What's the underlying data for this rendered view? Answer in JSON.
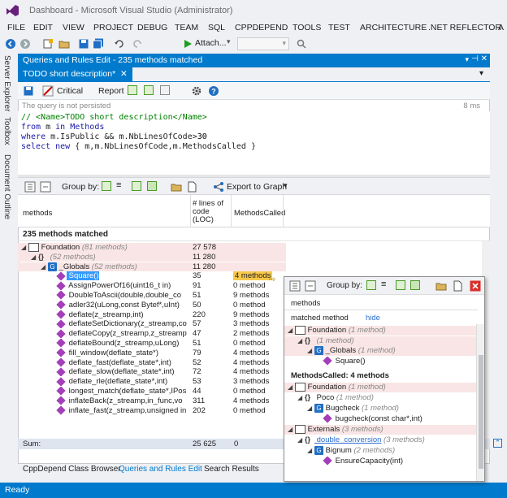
{
  "window": {
    "title": "Dashboard - Microsoft Visual Studio (Administrator)"
  },
  "menu": [
    "FILE",
    "EDIT",
    "VIEW",
    "PROJECT",
    "DEBUG",
    "TEAM",
    "SQL",
    "CPPDEPEND",
    "TOOLS",
    "TEST",
    "ARCHITECTURE",
    ".NET REFLECTOR",
    "A"
  ],
  "toolbar": {
    "attach_label": "Attach..."
  },
  "side_tabs": [
    "Server Explorer",
    "Toolbox",
    "Document Outline"
  ],
  "panel": {
    "header": "Queries and Rules Edit - 235 methods matched",
    "tab": "TODO short description*",
    "critical_label": "Critical",
    "report_label": "Report",
    "notice": "The query is not persisted",
    "time": "8 ms"
  },
  "code": {
    "line1": "// <Name>TODO short description</Name>",
    "line2_kw": "from",
    "line2_var": " m ",
    "line2_in": "in",
    "line2_rest": " Methods",
    "line3_kw": "where",
    "line3_rest": " m.IsPublic && m.NbLinesOfCode>",
    "line3_num": "30",
    "line4_kw": "select new",
    "line4_rest": " { m,m.NbLinesOfCode,m.MethodsCalled }"
  },
  "groupbar": {
    "group_by": "Group by:",
    "export": "Export to Graph"
  },
  "grid": {
    "col_methods": "methods",
    "col_loc": "# lines of code (LOC)",
    "col_called": "MethodsCalled",
    "matched": "235 methods matched",
    "rows": [
      {
        "indent": 0,
        "kind": "asm",
        "name": "Foundation",
        "note": "(81 methods)",
        "loc": "27 578",
        "called": "",
        "pink": true
      },
      {
        "indent": 1,
        "kind": "ns",
        "name": "",
        "note": "(52 methods)",
        "loc": "11 280",
        "called": "",
        "pink": true
      },
      {
        "indent": 2,
        "kind": "cls",
        "name": "_Globals",
        "note": "(52 methods)",
        "loc": "11 280",
        "called": "",
        "pink": true
      },
      {
        "indent": 3,
        "kind": "m",
        "name": "Square()",
        "note": "",
        "loc": "35",
        "called": "4 methods",
        "pink": false,
        "sel": true
      },
      {
        "indent": 3,
        "kind": "m",
        "name": "AssignPowerOf16(uint16_t in)",
        "note": "",
        "loc": "91",
        "called": "0 method",
        "pink": false
      },
      {
        "indent": 3,
        "kind": "m",
        "name": "DoubleToAscii(double,double_co",
        "note": "",
        "loc": "51",
        "called": "9 methods",
        "pink": false
      },
      {
        "indent": 3,
        "kind": "m",
        "name": "adler32(uLong,const Bytef*,uInt)",
        "note": "",
        "loc": "50",
        "called": "0 method",
        "pink": false
      },
      {
        "indent": 3,
        "kind": "m",
        "name": "deflate(z_streamp,int)",
        "note": "",
        "loc": "220",
        "called": "9 methods",
        "pink": false
      },
      {
        "indent": 3,
        "kind": "m",
        "name": "deflateSetDictionary(z_streamp,co",
        "note": "",
        "loc": "57",
        "called": "3 methods",
        "pink": false
      },
      {
        "indent": 3,
        "kind": "m",
        "name": "deflateCopy(z_streamp,z_streamp",
        "note": "",
        "loc": "47",
        "called": "2 methods",
        "pink": false
      },
      {
        "indent": 3,
        "kind": "m",
        "name": "deflateBound(z_streamp,uLong)",
        "note": "",
        "loc": "51",
        "called": "0 method",
        "pink": false
      },
      {
        "indent": 3,
        "kind": "m",
        "name": "fill_window(deflate_state*)",
        "note": "",
        "loc": "79",
        "called": "4 methods",
        "pink": false
      },
      {
        "indent": 3,
        "kind": "m",
        "name": "deflate_fast(deflate_state*,int)",
        "note": "",
        "loc": "52",
        "called": "4 methods",
        "pink": false
      },
      {
        "indent": 3,
        "kind": "m",
        "name": "deflate_slow(deflate_state*,int)",
        "note": "",
        "loc": "72",
        "called": "4 methods",
        "pink": false
      },
      {
        "indent": 3,
        "kind": "m",
        "name": "deflate_rle(deflate_state*,int)",
        "note": "",
        "loc": "53",
        "called": "3 methods",
        "pink": false
      },
      {
        "indent": 3,
        "kind": "m",
        "name": "longest_match(deflate_state*,IPos",
        "note": "",
        "loc": "44",
        "called": "0 method",
        "pink": false
      },
      {
        "indent": 3,
        "kind": "m",
        "name": "inflateBack(z_streamp,in_func,vo",
        "note": "",
        "loc": "311",
        "called": "4 methods",
        "pink": false
      },
      {
        "indent": 3,
        "kind": "m",
        "name": "inflate_fast(z_streamp,unsigned in",
        "note": "",
        "loc": "202",
        "called": "0 method",
        "pink": false
      }
    ],
    "sum_label": "Sum:",
    "sum_loc": "25 625",
    "sum_called": "0"
  },
  "bottom_tabs": [
    "CppDepend Class Browser",
    "Queries and Rules Edit",
    "Search Results"
  ],
  "status": "Ready",
  "popup": {
    "group_by": "Group by:",
    "col_methods": "methods",
    "matched_method": "matched method",
    "hide": "hide",
    "rows1": [
      {
        "indent": 0,
        "kind": "asm",
        "name": "Foundation",
        "note": "(1 method)"
      },
      {
        "indent": 1,
        "kind": "ns",
        "name": "",
        "note": "(1 method)"
      },
      {
        "indent": 2,
        "kind": "cls",
        "name": "_Globals",
        "note": "(1 method)"
      },
      {
        "indent": 3,
        "kind": "m",
        "name": "Square()",
        "note": ""
      }
    ],
    "called_title": "MethodsCalled: 4 methods",
    "rows2": [
      {
        "indent": 0,
        "kind": "asm",
        "name": "Foundation",
        "note": "(1 method)",
        "pink": true
      },
      {
        "indent": 1,
        "kind": "ns",
        "name": "Poco",
        "note": "(1 method)",
        "pink": false
      },
      {
        "indent": 2,
        "kind": "cls",
        "name": "Bugcheck",
        "note": "(1 method)",
        "pink": false
      },
      {
        "indent": 3,
        "kind": "m",
        "name": "bugcheck(const char*,int)",
        "note": "",
        "pink": false
      },
      {
        "indent": 0,
        "kind": "asm",
        "name": "Externals",
        "note": "(3 methods)",
        "pink": true
      },
      {
        "indent": 1,
        "kind": "ns",
        "name": "double_conversion",
        "note": "(3 methods)",
        "pink": false,
        "link": true
      },
      {
        "indent": 2,
        "kind": "cls",
        "name": "Bignum",
        "note": "(2 methods)",
        "pink": false
      },
      {
        "indent": 3,
        "kind": "m",
        "name": "EnsureCapacity(int)",
        "note": "",
        "pink": false
      }
    ]
  },
  "colors": {
    "accent": "#007acc",
    "selection": "#3399ff",
    "pink": "#f9e5e5"
  }
}
